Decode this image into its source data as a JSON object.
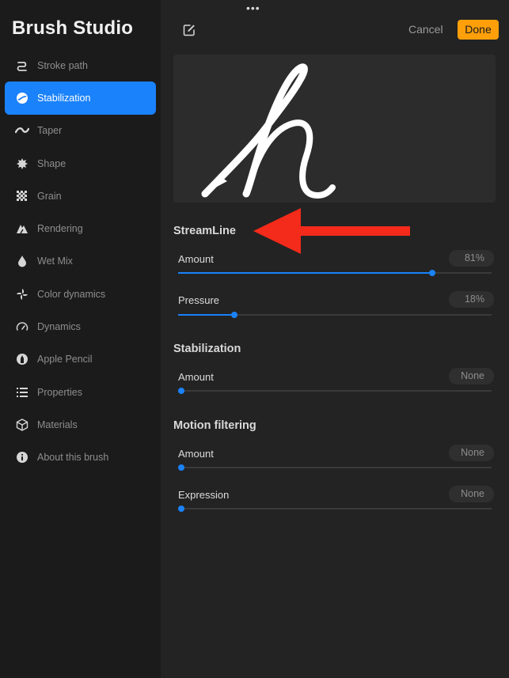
{
  "app": {
    "title": "Brush Studio"
  },
  "sidebar": {
    "items": [
      {
        "label": "Stroke path",
        "icon": "stroke-path-icon",
        "active": false
      },
      {
        "label": "Stabilization",
        "icon": "stabilization-icon",
        "active": true
      },
      {
        "label": "Taper",
        "icon": "taper-icon",
        "active": false
      },
      {
        "label": "Shape",
        "icon": "shape-icon",
        "active": false
      },
      {
        "label": "Grain",
        "icon": "grain-icon",
        "active": false
      },
      {
        "label": "Rendering",
        "icon": "rendering-icon",
        "active": false
      },
      {
        "label": "Wet Mix",
        "icon": "wet-mix-icon",
        "active": false
      },
      {
        "label": "Color dynamics",
        "icon": "color-dynamics-icon",
        "active": false
      },
      {
        "label": "Dynamics",
        "icon": "dynamics-icon",
        "active": false
      },
      {
        "label": "Apple Pencil",
        "icon": "apple-pencil-icon",
        "active": false
      },
      {
        "label": "Properties",
        "icon": "properties-icon",
        "active": false
      },
      {
        "label": "Materials",
        "icon": "materials-icon",
        "active": false
      },
      {
        "label": "About this brush",
        "icon": "info-icon",
        "active": false
      }
    ]
  },
  "header": {
    "grabber": "•••",
    "cancel_label": "Cancel",
    "done_label": "Done"
  },
  "sections": {
    "streamline": {
      "title": "StreamLine",
      "amount": {
        "label": "Amount",
        "value": "81%",
        "fraction": 0.81
      },
      "pressure": {
        "label": "Pressure",
        "value": "18%",
        "fraction": 0.18
      }
    },
    "stabilization": {
      "title": "Stabilization",
      "amount": {
        "label": "Amount",
        "value": "None",
        "fraction": 0
      }
    },
    "motion_filtering": {
      "title": "Motion filtering",
      "amount": {
        "label": "Amount",
        "value": "None",
        "fraction": 0
      },
      "expression": {
        "label": "Expression",
        "value": "None",
        "fraction": 0
      }
    }
  },
  "colors": {
    "accent": "#1a82fb",
    "done_button": "#ff9f0a",
    "annotation_arrow": "#f42a1a"
  }
}
